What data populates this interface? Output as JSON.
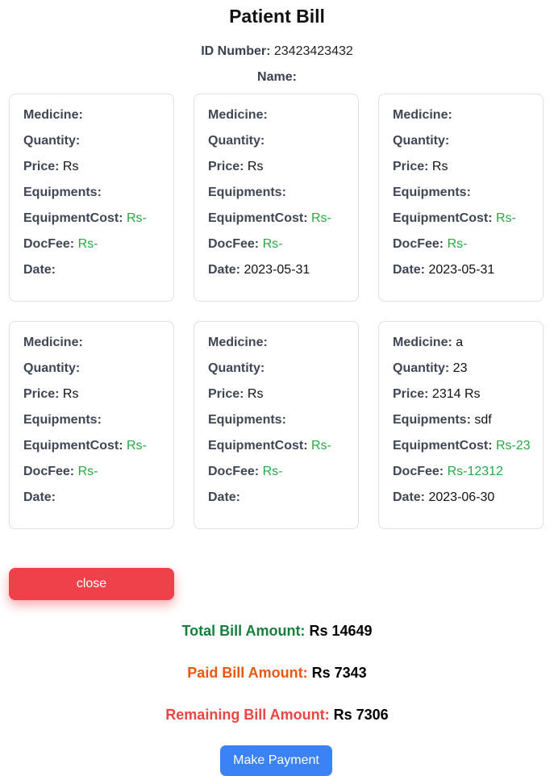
{
  "title": "Patient Bill",
  "patient": {
    "id_label": "ID Number:",
    "id_value": "23423423432",
    "name_label": "Name:",
    "name_value": ""
  },
  "labels": {
    "medicine": "Medicine:",
    "quantity": "Quantity:",
    "price": "Price:",
    "equipments": "Equipments:",
    "equipment_cost": "EquipmentCost:",
    "doc_fee": "DocFee:",
    "date": "Date:"
  },
  "records": [
    {
      "medicine": "",
      "quantity": "",
      "price": "Rs",
      "equipments": "",
      "equipment_cost": "Rs-",
      "doc_fee": "Rs-",
      "date": ""
    },
    {
      "medicine": "",
      "quantity": "",
      "price": "Rs",
      "equipments": "",
      "equipment_cost": "Rs-",
      "doc_fee": "Rs-",
      "date": "2023-05-31"
    },
    {
      "medicine": "",
      "quantity": "",
      "price": "Rs",
      "equipments": "",
      "equipment_cost": "Rs-",
      "doc_fee": "Rs-",
      "date": "2023-05-31"
    },
    {
      "medicine": "",
      "quantity": "",
      "price": "Rs",
      "equipments": "",
      "equipment_cost": "Rs-",
      "doc_fee": "Rs-",
      "date": ""
    },
    {
      "medicine": "",
      "quantity": "",
      "price": "Rs",
      "equipments": "",
      "equipment_cost": "Rs-",
      "doc_fee": "Rs-",
      "date": ""
    },
    {
      "medicine": "a",
      "quantity": "23",
      "price": "2314 Rs",
      "equipments": "sdf",
      "equipment_cost": "Rs-23",
      "doc_fee": "Rs-12312",
      "date": "2023-06-30"
    }
  ],
  "buttons": {
    "close": "close",
    "make_payment": "Make Payment"
  },
  "totals": {
    "total_label": "Total Bill Amount:",
    "total_value": "Rs 14649",
    "paid_label": "Paid Bill Amount:",
    "paid_value": "Rs 7343",
    "remaining_label": "Remaining Bill Amount:",
    "remaining_value": "Rs 7306"
  },
  "colors": {
    "close_button": "#ef4149",
    "pay_button": "#3b82f6",
    "total_label": "#15803d",
    "paid_label": "#ea580c",
    "remaining_label": "#ef4444",
    "cost_values": "#28a745"
  }
}
